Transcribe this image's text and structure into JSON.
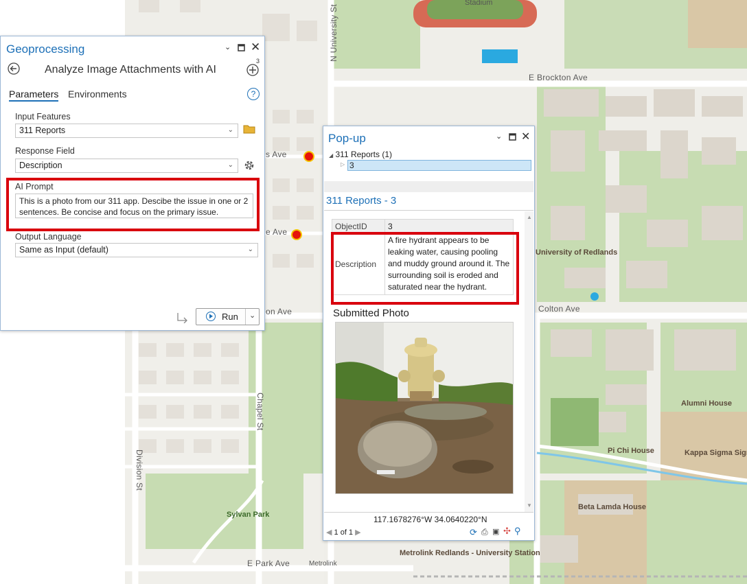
{
  "map": {
    "labels": {
      "stadium": "Stadium",
      "n_university_st": "N University St",
      "e_brockton_ave": "E Brockton Ave",
      "s_ave": "s Ave",
      "e_ave": "e Ave",
      "on_ave": "on Ave",
      "colton_ave": "Colton Ave",
      "university_of_redlands": "University of Redlands",
      "alumni_house": "Alumni House",
      "chapel_st": "Chapel St",
      "division_st": "Division St",
      "pi_chi_house": "Pi Chi House",
      "kappa_sigma": "Kappa Sigma Sigma House",
      "beta_lamda": "Beta Lamda House",
      "sylvan_park": "Sylvan Park",
      "e_park_ave": "E Park Ave",
      "metrolink": "Metrolink",
      "metrolink_station": "Metrolink Redlands - University Station"
    },
    "colors": {
      "point_fill": "#e5150b",
      "point_stroke": "#f5c400",
      "park": "#c5dcb0",
      "building": "#dcd6cc",
      "road": "#ffffff"
    }
  },
  "geoprocessing": {
    "title": "Geoprocessing",
    "tool_title": "Analyze Image Attachments with AI",
    "add_badge": "3",
    "tabs": {
      "parameters": "Parameters",
      "environments": "Environments"
    },
    "help": "?",
    "input_features": {
      "label": "Input Features",
      "value": "311 Reports"
    },
    "response_field": {
      "label": "Response Field",
      "value": "Description"
    },
    "ai_prompt": {
      "label": "AI Prompt",
      "value": "This is a photo from our 311 app. Descibe the issue in one or 2 sentences. Be concise and focus on the primary issue."
    },
    "output_language": {
      "label": "Output Language",
      "value": "Same as Input (default)"
    },
    "run_label": "Run",
    "icons": {
      "back": "back-arrow-icon",
      "add": "add-circle-icon",
      "folder": "folder-icon",
      "gear": "gear-icon"
    }
  },
  "popup": {
    "title": "Pop-up",
    "tree_layer": "311 Reports (1)",
    "tree_item": "3",
    "section_title": "311 Reports - 3",
    "rows": [
      {
        "field": "ObjectID",
        "value": "3"
      },
      {
        "field": "Description",
        "value": "A fire hydrant appears to be leaking water, causing pooling and muddy ground around it. The surrounding soil is eroded and saturated near the hydrant."
      }
    ],
    "photo_label": "Submitted Photo",
    "coordinates": "117.1678276°W 34.0640220°N",
    "pager": "1 of 1",
    "accent": "#1d70b7"
  }
}
